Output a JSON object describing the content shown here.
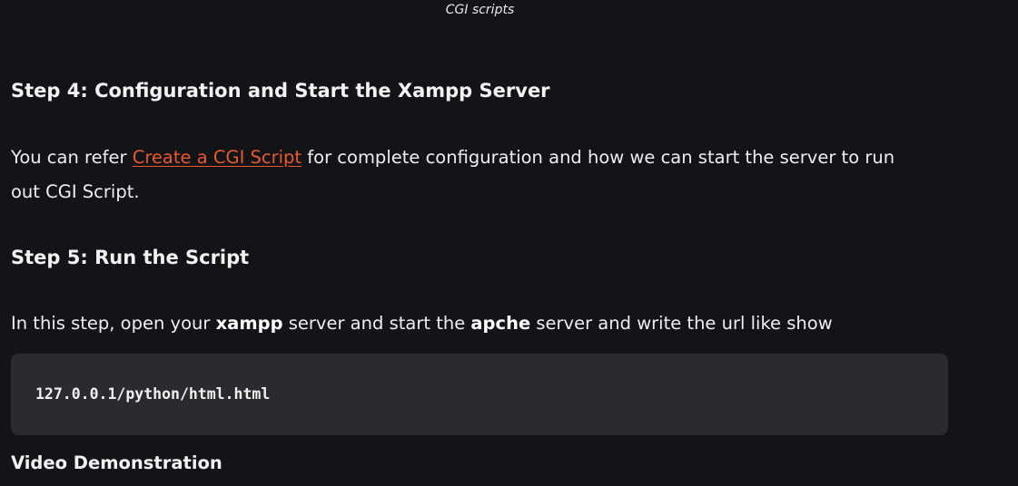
{
  "figure": {
    "caption": "CGI scripts"
  },
  "step4": {
    "heading": "Step 4: Configuration and Start the Xampp Server",
    "text_before_link": "You can refer ",
    "link_text": "Create a CGI Script",
    "text_after_link": " for complete configuration and how we can start the server to run out CGI Script."
  },
  "step5": {
    "heading": "Step 5: Run the Script",
    "text_1": "In this step, open your ",
    "bold_1": "xampp",
    "text_2": " server and start the ",
    "bold_2": "apche",
    "text_3": " server and write the url like show"
  },
  "code": {
    "content": "127.0.0.1/python/html.html"
  },
  "video": {
    "heading": "Video Demonstration"
  },
  "colors": {
    "background": "#131417",
    "link": "#e8592b",
    "code_background": "#2a2b2e"
  }
}
